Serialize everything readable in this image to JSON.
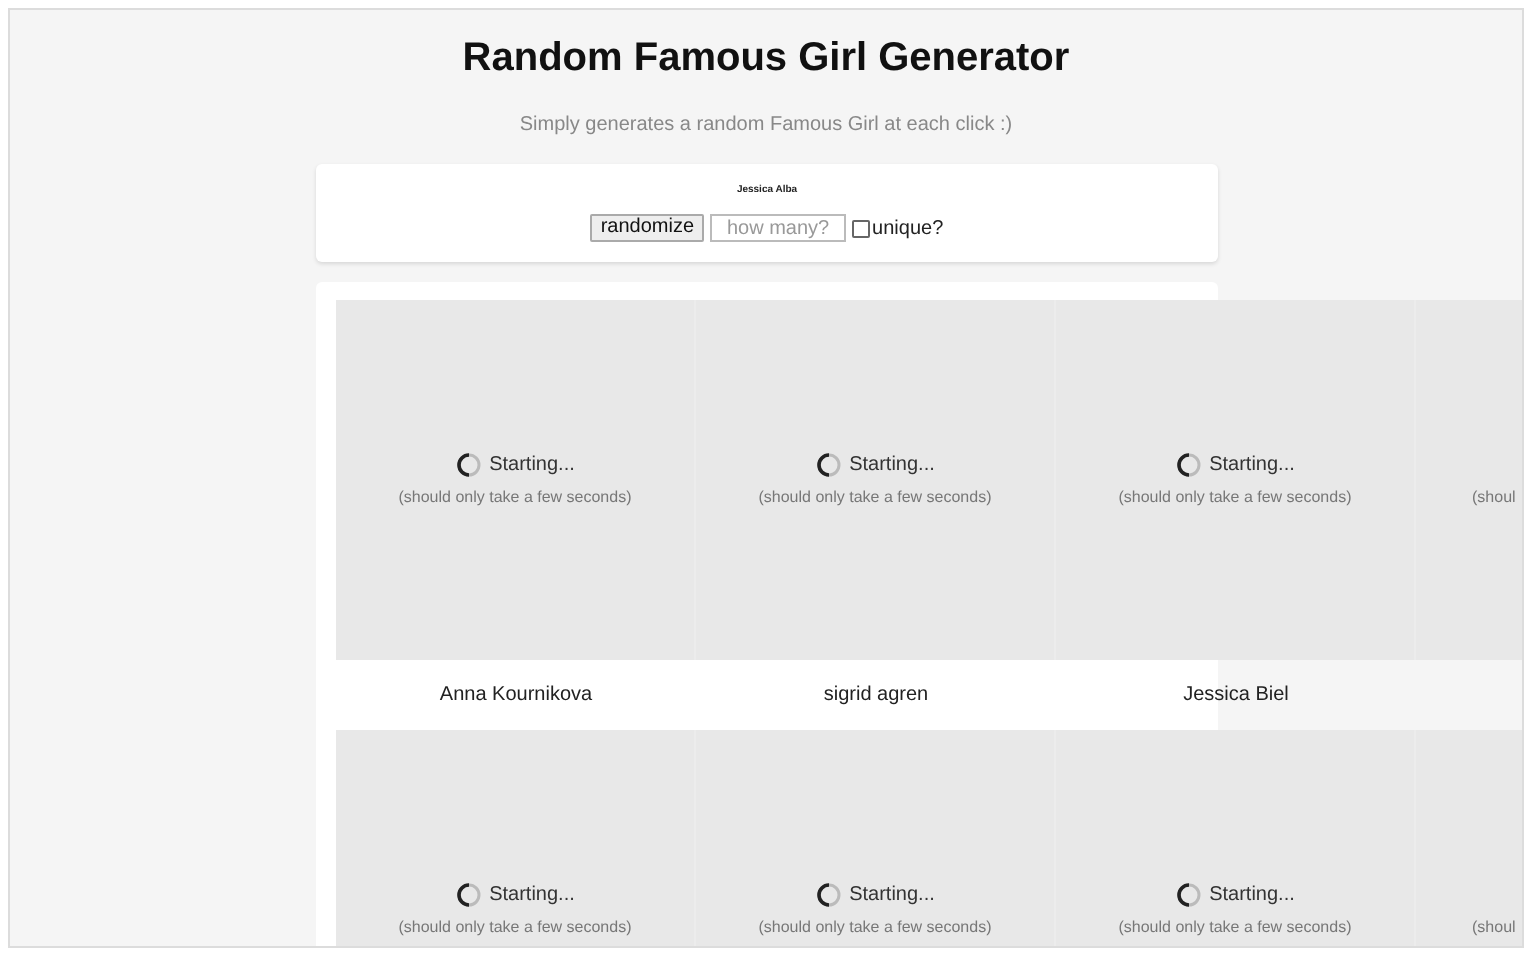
{
  "title": "Random Famous Girl Generator",
  "subtitle": "Simply generates a random Famous Girl at each click :)",
  "current_name": "Jessica Alba",
  "controls": {
    "button": "randomize",
    "count_placeholder": "how many?",
    "unique_label": "unique?",
    "unique_checked": false
  },
  "rows": [
    {
      "tiles": [
        {
          "status": "Starting...",
          "hint": "(should only take a few seconds)",
          "name": "Anna Kournikova"
        },
        {
          "status": "Starting...",
          "hint": "(should only take a few seconds)",
          "name": "sigrid agren"
        },
        {
          "status": "Starting...",
          "hint": "(should only take a few seconds)",
          "name": "Jessica Biel"
        },
        {
          "hint": "(shoul"
        }
      ]
    },
    {
      "tiles": [
        {
          "status": "Starting...",
          "hint": "(should only take a few seconds)"
        },
        {
          "status": "Starting...",
          "hint": "(should only take a few seconds)"
        },
        {
          "status": "Starting...",
          "hint": "(should only take a few seconds)"
        },
        {
          "hint": "(shoul"
        }
      ]
    }
  ]
}
